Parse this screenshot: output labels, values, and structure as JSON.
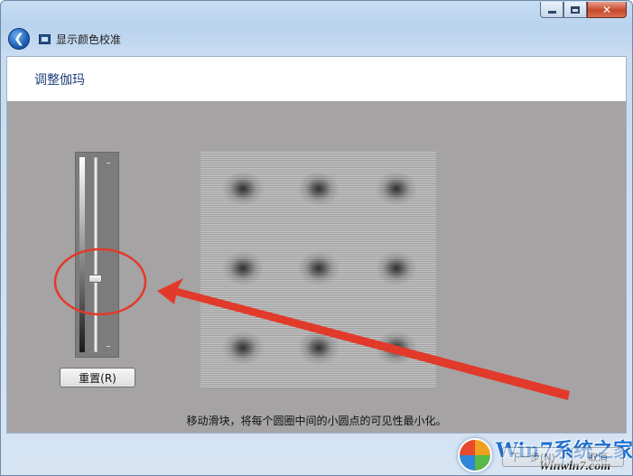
{
  "window": {
    "title": "显示颜色校准",
    "minimize_glyph": "–",
    "maximize_glyph": "□",
    "close_glyph": "✕"
  },
  "page": {
    "heading": "调整伽玛",
    "instruction": "移动滑块，将每个圆圈中间的小圆点的可见性最小化。"
  },
  "gamma_slider": {
    "level": 0.63
  },
  "buttons": {
    "reset": "重置(R)",
    "next": "下一步(N)",
    "cancel": "取消"
  },
  "watermark": {
    "brand": "Win7系统之家",
    "url": "Winwin7.com"
  },
  "colors": {
    "annotation_red": "#e23a2a",
    "heading_blue": "#1f3f7a",
    "panel_gray": "#a5a3a4"
  },
  "icons": {
    "back": "back-arrow-icon",
    "app": "display-monitor-icon"
  }
}
